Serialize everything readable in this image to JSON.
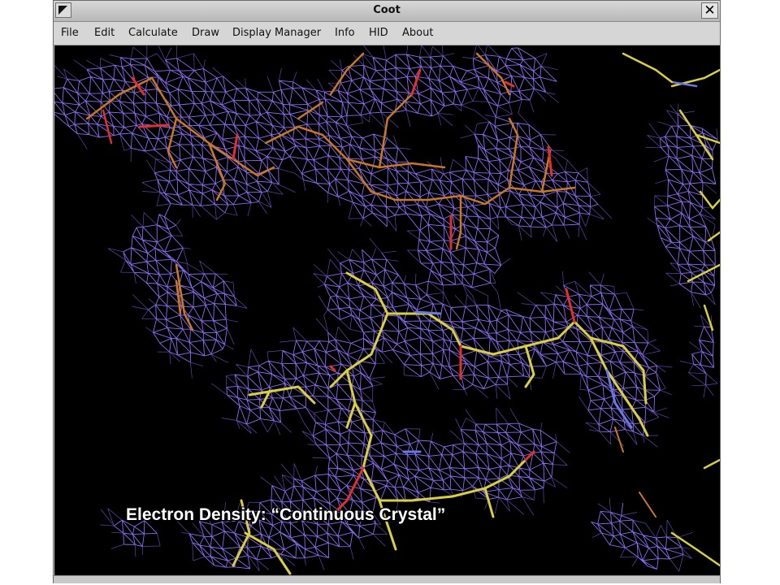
{
  "window": {
    "title": "Coot",
    "close_glyph": "✕"
  },
  "menubar": {
    "items": [
      {
        "label": "File"
      },
      {
        "label": "Edit"
      },
      {
        "label": "Calculate"
      },
      {
        "label": "Draw"
      },
      {
        "label": "Display Manager"
      },
      {
        "label": "Info"
      },
      {
        "label": "HID"
      },
      {
        "label": "About"
      }
    ]
  },
  "viewport": {
    "caption": "Electron Density: “Continuous Crystal”",
    "colors": {
      "background": "#000000",
      "mesh": "#8a6cf0",
      "mesh_dim": "#5c48a8",
      "carbon_active": "#d8d040",
      "carbon_other": "#c87828",
      "oxygen": "#e03030",
      "nitrogen": "#6a78e0"
    }
  }
}
